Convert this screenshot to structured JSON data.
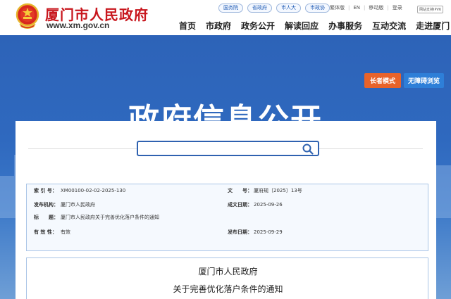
{
  "header": {
    "site_name": "厦门市人民政府",
    "site_url": "www.xm.gov.cn",
    "emblem_icon": "national-emblem-icon",
    "top_links": [
      "国务院",
      "省政府",
      "市人大",
      "市政协"
    ],
    "util_links": [
      "繁体版",
      "EN",
      "移动版",
      "登录"
    ],
    "ipv6_badge": "网站支持IPV6",
    "nav_items": [
      "首页",
      "市政府",
      "政务公开",
      "解读回应",
      "办事服务",
      "互动交流",
      "走进厦门"
    ]
  },
  "banner": {
    "title": "政府信息公开",
    "elder_mode_label": "长者模式",
    "barrier_free_label": "无障碍浏览"
  },
  "search": {
    "placeholder": "",
    "icon": "search-icon"
  },
  "info": {
    "index_label": "索 引 号：",
    "index_value": "XM00100-02-02-2025-130",
    "doc_no_label": "文　　号：",
    "doc_no_value": "厦府规〔2025〕13号",
    "issuer_label": "发布机构：",
    "issuer_value": "厦门市人民政府",
    "created_label": "成文日期：",
    "created_value": "2025-09-26",
    "title_label": "标　　题：",
    "title_value": "厦门市人民政府关于完善优化落户条件的通知",
    "validity_label": "有 效 性：",
    "validity_value": "有效",
    "published_label": "发布日期：",
    "published_value": "2025-09-29"
  },
  "document": {
    "org": "厦门市人民政府",
    "title": "关于完善优化落户条件的通知"
  },
  "colors": {
    "brand_red": "#c8161d",
    "banner_blue": "#2f69bf",
    "accent_orange": "#e8632a",
    "accent_blue": "#2e7fd8"
  }
}
